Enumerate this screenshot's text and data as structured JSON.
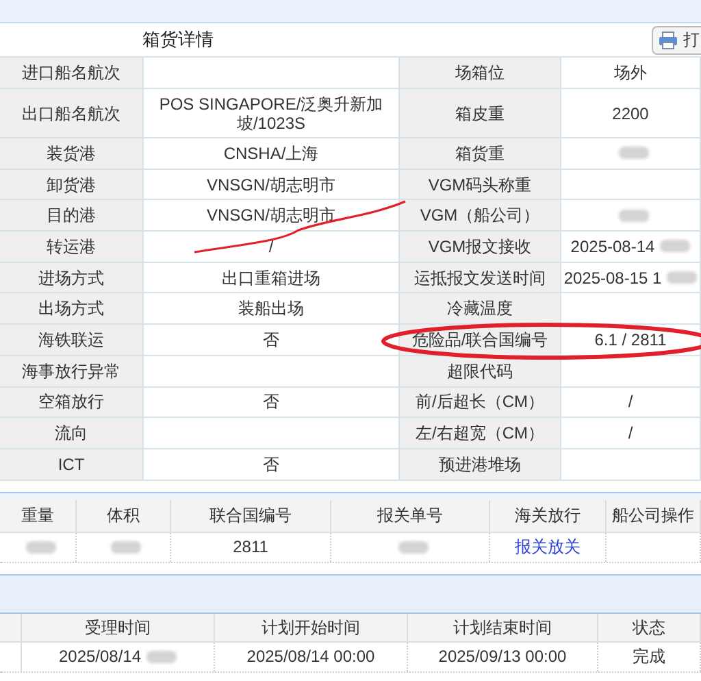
{
  "title": "箱货详情",
  "print_button": "打",
  "details": [
    {
      "left": {
        "label": "进口船名航次",
        "redacted": false
      },
      "right": {
        "label": "场箱位",
        "value": "场外",
        "redacted": false
      }
    },
    {
      "left": {
        "label": "出口船名航次",
        "value": "POS SINGAPORE/泛奥升新加坡/1023S",
        "redacted": false
      },
      "right": {
        "label": "箱皮重",
        "value": "2200",
        "redacted": false
      }
    },
    {
      "left": {
        "label": "装货港",
        "value": "CNSHA/上海",
        "redacted": false
      },
      "right": {
        "label": "箱货重",
        "redacted": true
      }
    },
    {
      "left": {
        "label": "卸货港",
        "value": "VNSGN/胡志明市",
        "redacted": false
      },
      "right": {
        "label": "VGM码头称重",
        "redacted": false
      }
    },
    {
      "left": {
        "label": "目的港",
        "value": "VNSGN/胡志明市",
        "redacted": false
      },
      "right": {
        "label": "VGM（船公司）",
        "redacted": true
      }
    },
    {
      "left": {
        "label": "转运港",
        "value": "/",
        "redacted": false
      },
      "right": {
        "label": "VGM报文接收",
        "value": "2025-08-14",
        "redacted": true
      }
    },
    {
      "left": {
        "label": "进场方式",
        "value": "出口重箱进场",
        "redacted": false
      },
      "right": {
        "label": "运抵报文发送时间",
        "value": "2025-08-15 1",
        "redacted": true
      }
    },
    {
      "left": {
        "label": "出场方式",
        "value": "装船出场",
        "redacted": false
      },
      "right": {
        "label": "冷藏温度",
        "redacted": false
      }
    },
    {
      "left": {
        "label": "海铁联运",
        "value": "否",
        "redacted": false
      },
      "right": {
        "label": "危险品/联合国编号",
        "value": "6.1 / 2811",
        "redacted": false
      }
    },
    {
      "left": {
        "label": "海事放行异常",
        "redacted": false
      },
      "right": {
        "label": "超限代码",
        "redacted": false
      }
    },
    {
      "left": {
        "label": "空箱放行",
        "value": "否",
        "redacted": false
      },
      "right": {
        "label": "前/后超长（CM）",
        "value": "/",
        "redacted": false
      }
    },
    {
      "left": {
        "label": "流向",
        "redacted": false
      },
      "right": {
        "label": "左/右超宽（CM）",
        "value": "/",
        "redacted": false
      }
    },
    {
      "left": {
        "label": "ICT",
        "value": "否",
        "redacted": false
      },
      "right": {
        "label": "预进港堆场",
        "redacted": false
      }
    }
  ],
  "cargo_table": {
    "columns": [
      "重量",
      "体积",
      "联合国编号",
      "报关单号",
      "海关放行",
      "船公司操作"
    ],
    "rows": [
      [
        {
          "redacted": true
        },
        {
          "redacted": true
        },
        {
          "kind": "text",
          "text": "2811",
          "redacted": false
        },
        {
          "redacted": true
        },
        {
          "kind": "link",
          "text": "报关放关",
          "redacted": false
        },
        {
          "redacted": false
        }
      ]
    ]
  },
  "schedule_table": {
    "columns": [
      "受理时间",
      "计划开始时间",
      "计划结束时间",
      "状态"
    ],
    "rows": [
      [
        {
          "text": "2025/08/14",
          "redacted": true
        },
        {
          "text": "2025/08/14 00:00",
          "redacted": false
        },
        {
          "text": "2025/09/13 00:00",
          "redacted": false
        },
        {
          "text": "完成",
          "redacted": false
        }
      ]
    ]
  }
}
